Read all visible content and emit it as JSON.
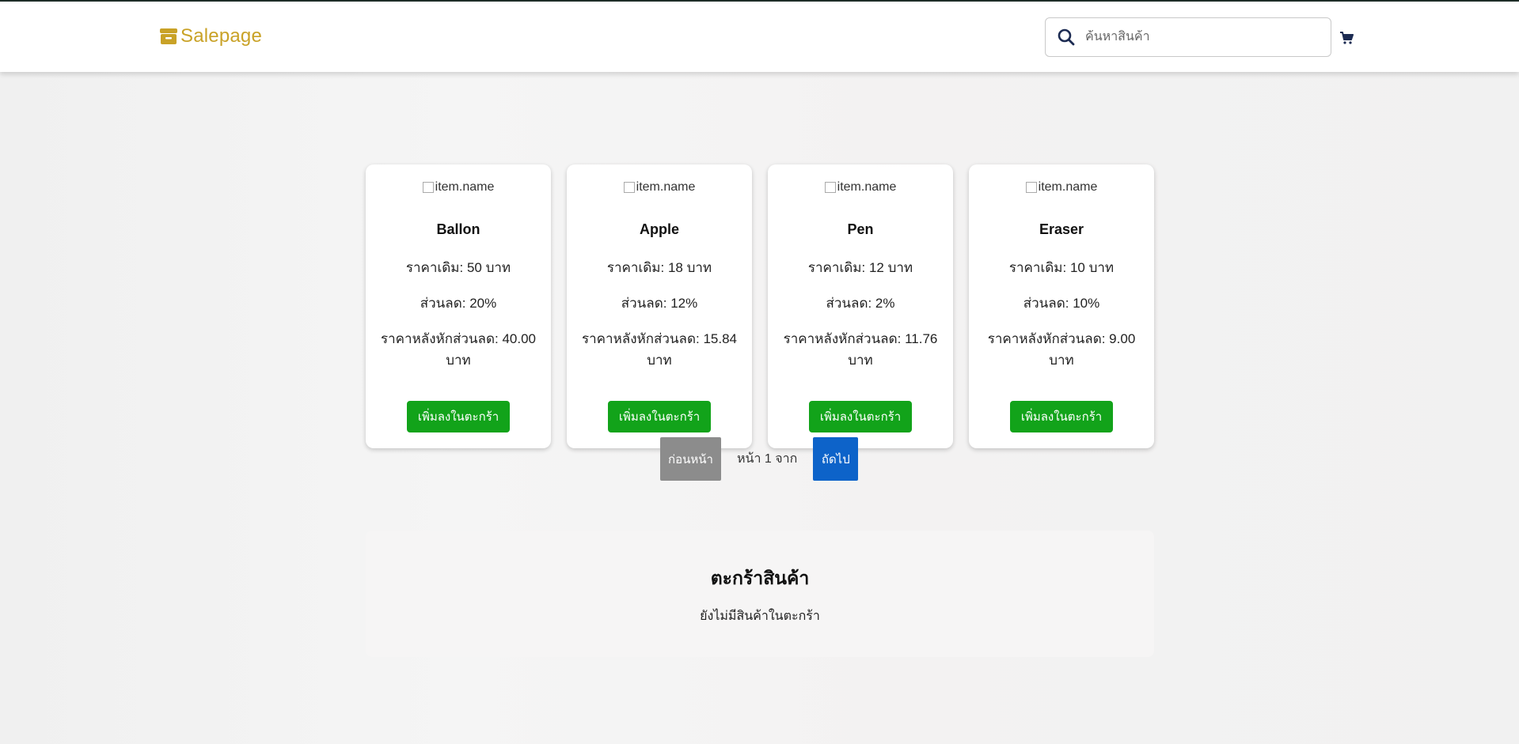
{
  "brand": {
    "name": "Salepage",
    "color": "#c9a227"
  },
  "search": {
    "placeholder": "ค้นหาสินค้า"
  },
  "products": [
    {
      "img_alt": "item.name",
      "name": "Ballon",
      "original": "ราคาเดิม: 50 บาท",
      "discount": "ส่วนลด: 20%",
      "final": "ราคาหลังหักส่วนลด: 40.00 บาท",
      "button": "เพิ่มลงในตะกร้า"
    },
    {
      "img_alt": "item.name",
      "name": "Apple",
      "original": "ราคาเดิม: 18 บาท",
      "discount": "ส่วนลด: 12%",
      "final": "ราคาหลังหักส่วนลด: 15.84 บาท",
      "button": "เพิ่มลงในตะกร้า"
    },
    {
      "img_alt": "item.name",
      "name": "Pen",
      "original": "ราคาเดิม: 12 บาท",
      "discount": "ส่วนลด: 2%",
      "final": "ราคาหลังหักส่วนลด: 11.76 บาท",
      "button": "เพิ่มลงในตะกร้า"
    },
    {
      "img_alt": "item.name",
      "name": "Eraser",
      "original": "ราคาเดิม: 10 บาท",
      "discount": "ส่วนลด: 10%",
      "final": "ราคาหลังหักส่วนลด: 9.00 บาท",
      "button": "เพิ่มลงในตะกร้า"
    }
  ],
  "pagination": {
    "prev": "ก่อนหน้า",
    "info": "หน้า 1 จาก",
    "next": "ถัดไป"
  },
  "cart": {
    "title": "ตะกร้าสินค้า",
    "empty": "ยังไม่มีสินค้าในตะกร้า"
  },
  "colors": {
    "add_button": "#12a31a",
    "next_button": "#0d63c9",
    "prev_button": "#8c8c8c"
  },
  "icons": {
    "brand": "store-icon",
    "search": "search-icon",
    "cart": "cart-icon"
  }
}
